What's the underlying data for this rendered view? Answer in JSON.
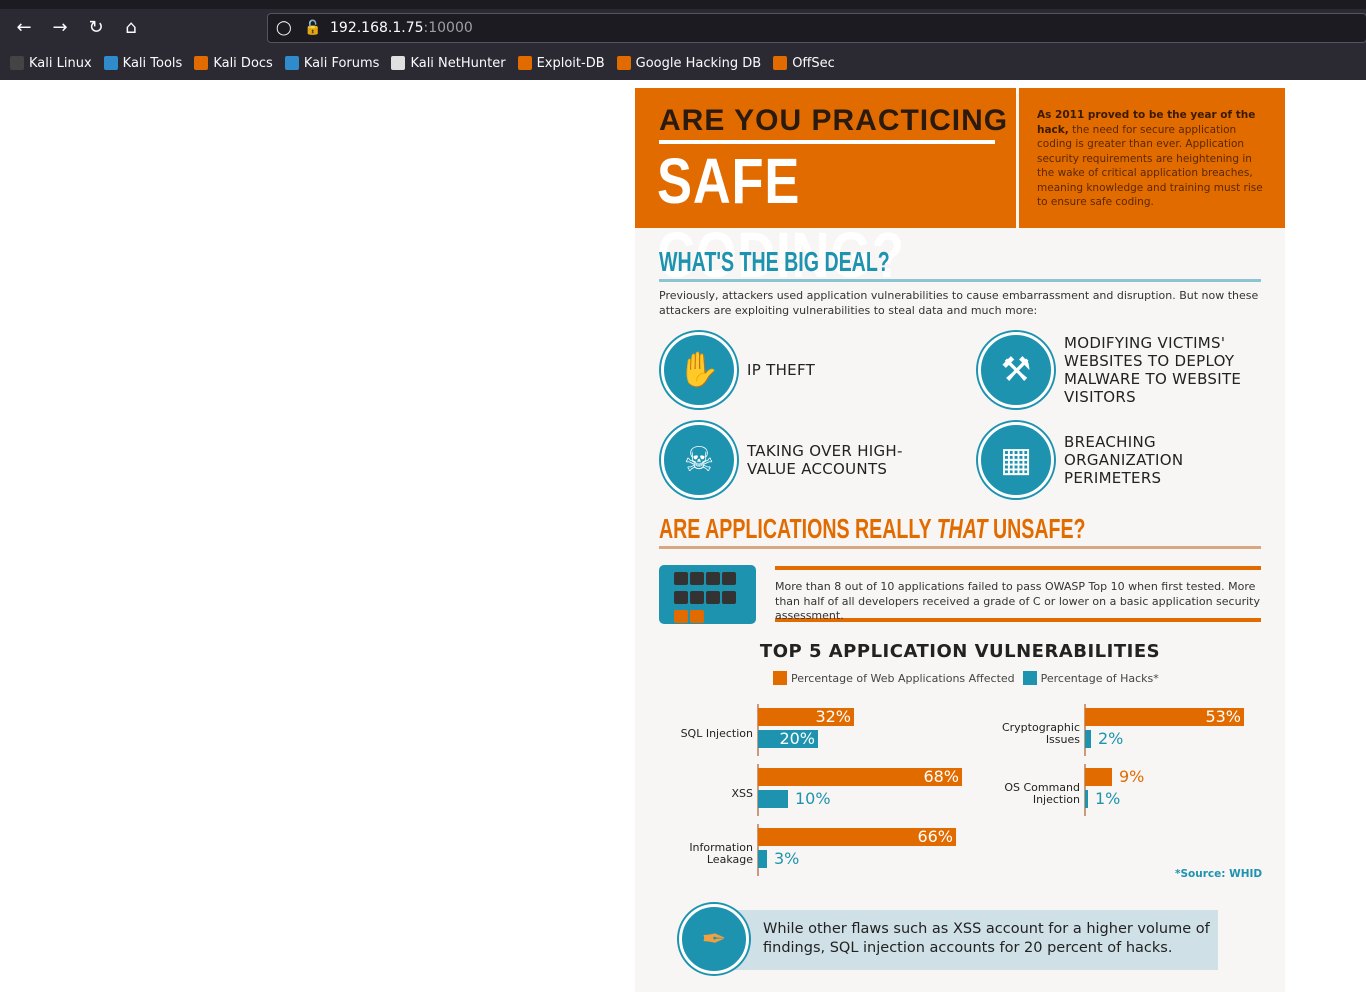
{
  "browser": {
    "url_host": "192.168.1.75",
    "url_port": ":10000",
    "bookmarks": [
      {
        "label": "Kali Linux",
        "color": "#444"
      },
      {
        "label": "Kali Tools",
        "color": "#2f8bc9"
      },
      {
        "label": "Kali Docs",
        "color": "#e26b00"
      },
      {
        "label": "Kali Forums",
        "color": "#2f8bc9"
      },
      {
        "label": "Kali NetHunter",
        "color": "#e0e0e0"
      },
      {
        "label": "Exploit-DB",
        "color": "#e26b00"
      },
      {
        "label": "Google Hacking DB",
        "color": "#e26b00"
      },
      {
        "label": "OffSec",
        "color": "#e26b00"
      }
    ]
  },
  "infographic": {
    "header_line1": "ARE YOU PRACTICING",
    "header_line2": "SAFE CODING?",
    "intro_bold": "As 2011 proved to be the year of the hack,",
    "intro_rest": " the need for secure application coding is greater than ever. Application security requirements are heightening in the wake of critical application breaches, meaning knowledge and training must rise to ensure safe coding.",
    "section1_title": "WHAT'S THE BIG DEAL?",
    "section1_text": "Previously, attackers used application vulnerabilities to cause embarrassment and disruption. But now these attackers are exploiting vulnerabilities to steal data and much more:",
    "threats": [
      {
        "label": "IP THEFT",
        "icon": "head-hand-icon"
      },
      {
        "label": "MODIFYING VICTIMS' WEBSITES TO DEPLOY MALWARE TO WEBSITE VISITORS",
        "icon": "hammer-icon"
      },
      {
        "label": "TAKING OVER HIGH-VALUE ACCOUNTS",
        "icon": "skull-crossbones-icon"
      },
      {
        "label": "BREACHING ORGANIZATION PERIMETERS",
        "icon": "brick-wall-icon"
      }
    ],
    "section2_title_a": "ARE APPLICATIONS REALLY ",
    "section2_title_b": "THAT",
    "section2_title_c": " UNSAFE?",
    "section2_text": "More than 8 out of 10 applications failed to pass OWASP Top 10 when first tested. More than half of all developers received a grade of C or lower on a basic application security assessment.",
    "source": "*Source: WHID",
    "note": "While other flaws such as XSS account for a higher volume of findings, SQL injection accounts for 20 percent of hacks."
  },
  "colors": {
    "orange": "#e26b00",
    "teal": "#1e93b0"
  },
  "chart_data": {
    "type": "bar",
    "orientation": "horizontal",
    "title": "TOP 5 APPLICATION VULNERABILITIES",
    "categories": [
      "SQL Injection",
      "XSS",
      "Information Leakage",
      "Cryptographic Issues",
      "OS Command Injection"
    ],
    "series": [
      {
        "name": "Percentage of Web Applications Affected",
        "color": "#e26b00",
        "values": [
          32,
          68,
          66,
          53,
          9
        ]
      },
      {
        "name": "Percentage of Hacks*",
        "color": "#1e93b0",
        "values": [
          20,
          10,
          3,
          2,
          1
        ]
      }
    ],
    "unit": "%",
    "legend": "top"
  }
}
